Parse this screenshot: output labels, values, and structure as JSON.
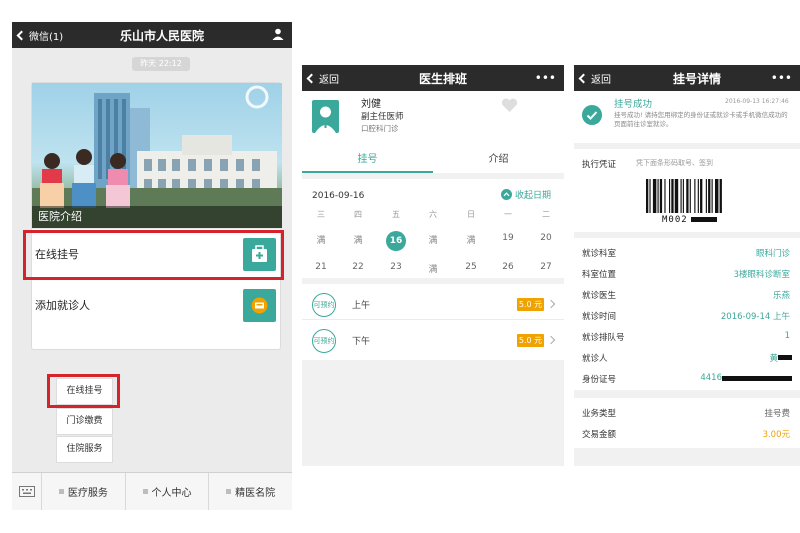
{
  "panel1": {
    "nav_back": "微信(1)",
    "title": "乐山市人民医院",
    "time": "昨天 22:12",
    "hero_caption": "医院介绍",
    "row1_label": "在线挂号",
    "row2_label": "添加就诊人",
    "popup": [
      "在线挂号",
      "门诊缴费",
      "住院服务"
    ],
    "bottom_menu": [
      "医疗服务",
      "个人中心",
      "精医名院"
    ],
    "accent": "#3aa89a",
    "highlight": "#d4232a"
  },
  "panel2": {
    "nav_back": "返回",
    "title": "医生排班",
    "doctor_name": "刘健",
    "doctor_title": "副主任医师",
    "doctor_dept": "口腔科门诊",
    "tabs": [
      "挂号",
      "介绍"
    ],
    "date": "2016-09-16",
    "collapse_label": "收起日期",
    "weekdays": [
      "三",
      "四",
      "五",
      "六",
      "日",
      "一",
      "二"
    ],
    "row1": [
      "满",
      "满",
      "16",
      "满",
      "满",
      "19",
      "20"
    ],
    "row2": [
      "21",
      "22",
      "23",
      "满",
      "25",
      "26",
      "27"
    ],
    "selected": "16",
    "slots": [
      {
        "badge": "可预约",
        "label": "上午",
        "price": "5.0 元"
      },
      {
        "badge": "可预约",
        "label": "下午",
        "price": "5.0 元"
      }
    ]
  },
  "panel3": {
    "nav_back": "返回",
    "title": "挂号详情",
    "status": "挂号成功",
    "status_time": "2016-09-13 16:27:46",
    "status_msg": "挂号成功! 请持您用绑定的身份证或就诊卡或手机微信成功的页面前往诊室就诊。",
    "voucher_label": "执行凭证",
    "voucher_hint": "凭下面条形码取号、签到",
    "barcode_text": "M002",
    "rows": [
      {
        "k": "就诊科室",
        "v": "眼科门诊"
      },
      {
        "k": "科室位置",
        "v": "3楼眼科诊断室"
      },
      {
        "k": "就诊医生",
        "v": "乐燕"
      },
      {
        "k": "就诊时间",
        "v": "2016-09-14 上午"
      },
      {
        "k": "就诊排队号",
        "v": "1"
      },
      {
        "k": "就诊人",
        "v": "黄"
      },
      {
        "k": "身份证号",
        "v": "4416"
      }
    ],
    "rows2": [
      {
        "k": "业务类型",
        "v": "挂号费"
      },
      {
        "k": "交易金额",
        "v": "3.00元"
      }
    ]
  }
}
